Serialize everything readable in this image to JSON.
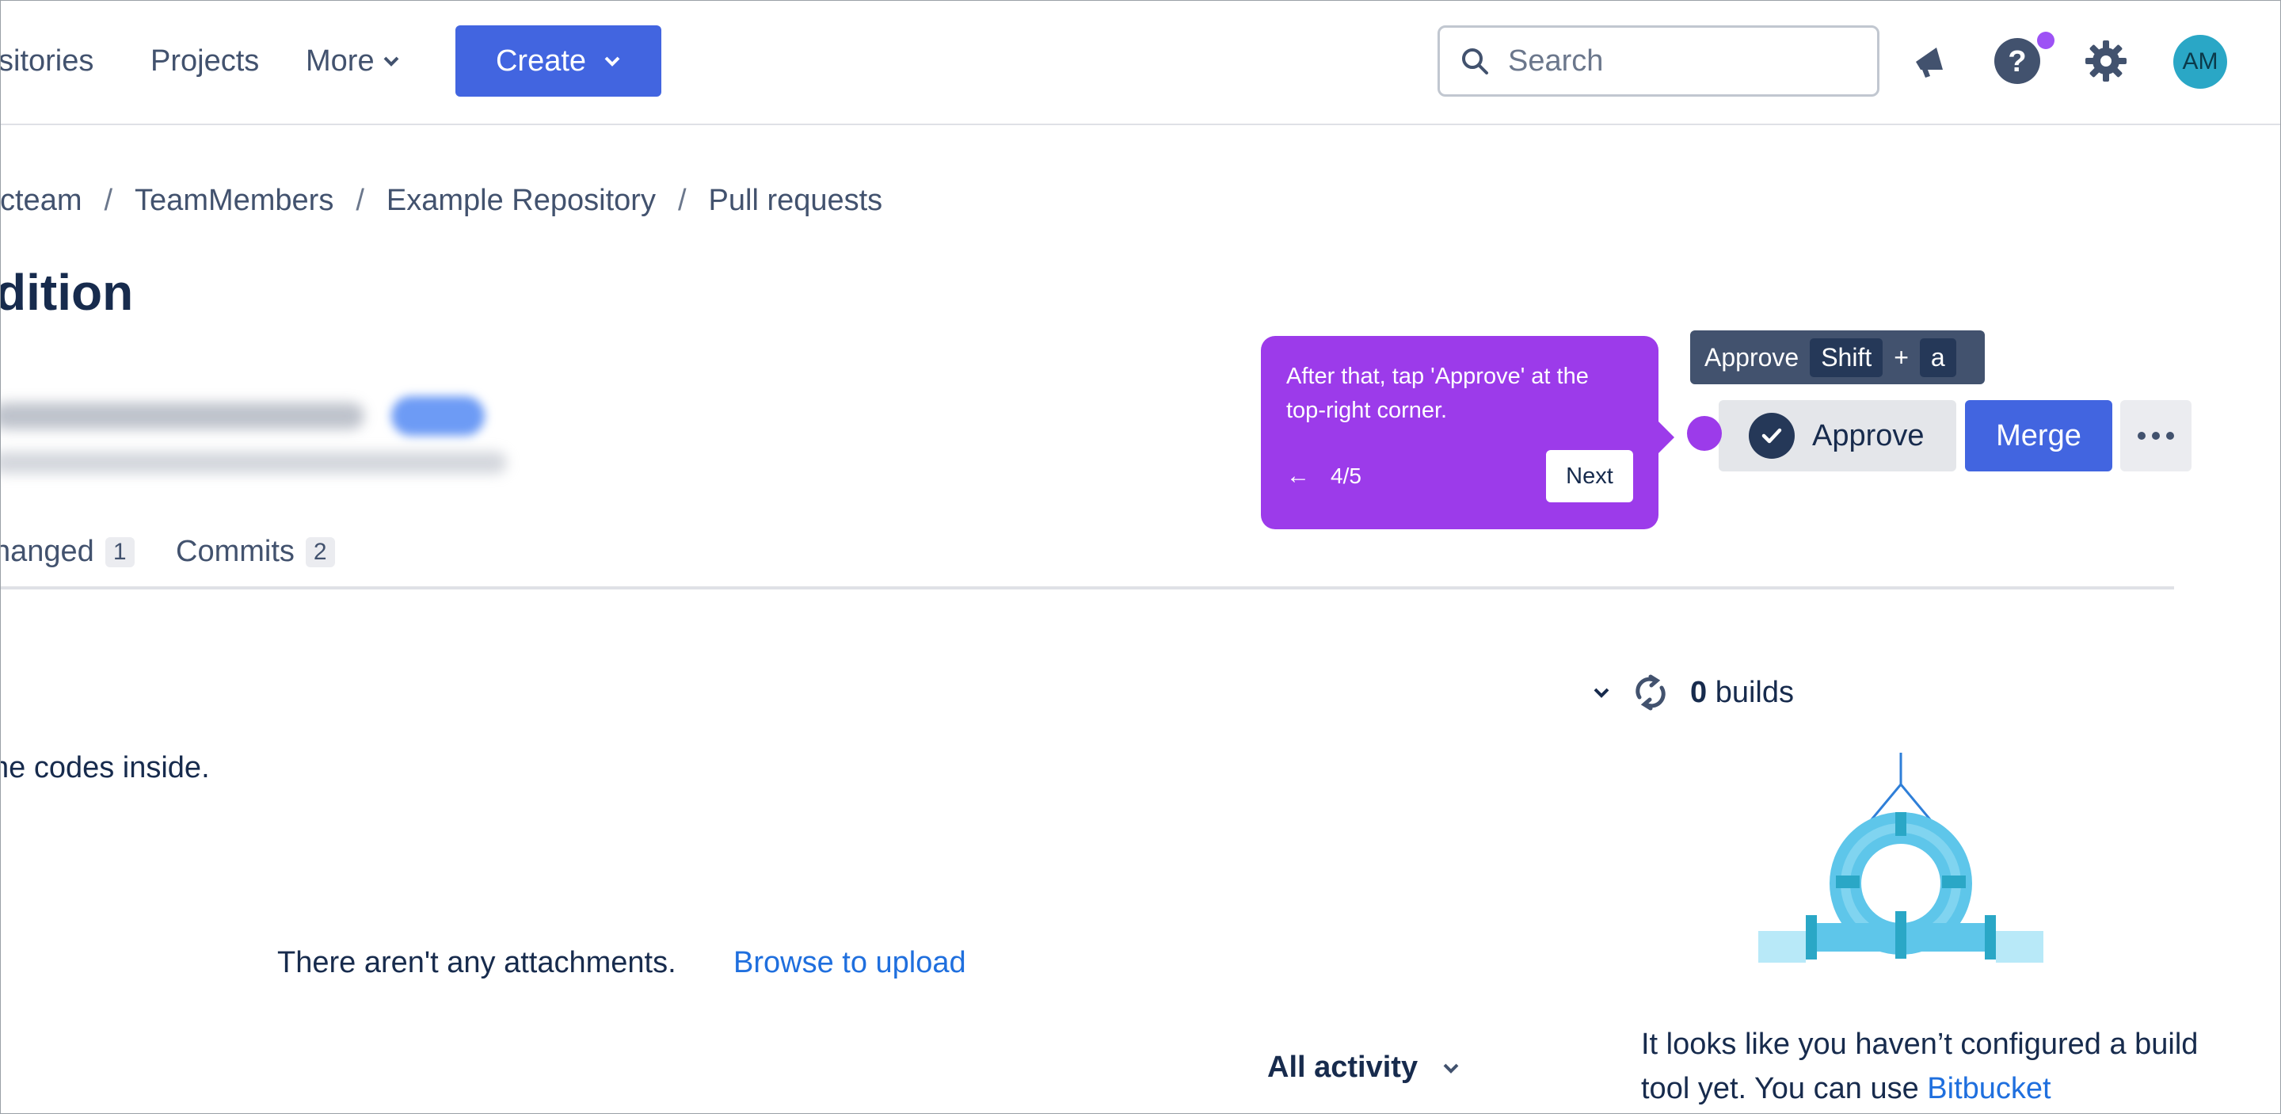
{
  "nav": {
    "repositories_partial": "sitories",
    "projects": "Projects",
    "more": "More",
    "create": "Create",
    "search_placeholder": "Search",
    "avatar_initials": "AM"
  },
  "breadcrumb": {
    "team_partial": "cteam",
    "members": "TeamMembers",
    "repo": "Example Repository",
    "pull_requests": "Pull requests",
    "separator": "/"
  },
  "page": {
    "title_partial": "dition"
  },
  "tabs": [
    {
      "label": "hanged",
      "count": "1"
    },
    {
      "label": "Commits",
      "count": "2"
    }
  ],
  "description_partial": "he codes inside.",
  "attachments": {
    "empty_text": "There aren't any attachments.",
    "upload_link": "Browse to upload"
  },
  "activity_filter": "All activity",
  "actions": {
    "tooltip_label": "Approve",
    "shortcut_key1": "Shift",
    "shortcut_plus": "+",
    "shortcut_key2": "a",
    "approve": "Approve",
    "merge": "Merge"
  },
  "guide": {
    "text": "After that, tap 'Approve' at the top-right corner.",
    "step": "4/5",
    "next": "Next",
    "prev_arrow": "←"
  },
  "builds": {
    "count": "0",
    "label": "builds",
    "text_before": "It looks like you haven’t configured a build tool yet. You can use ",
    "link": "Bitbucket"
  },
  "colors": {
    "accent": "#4265e0",
    "guide": "#9c3bea",
    "link": "#1f6fde",
    "text": "#172b4d"
  }
}
